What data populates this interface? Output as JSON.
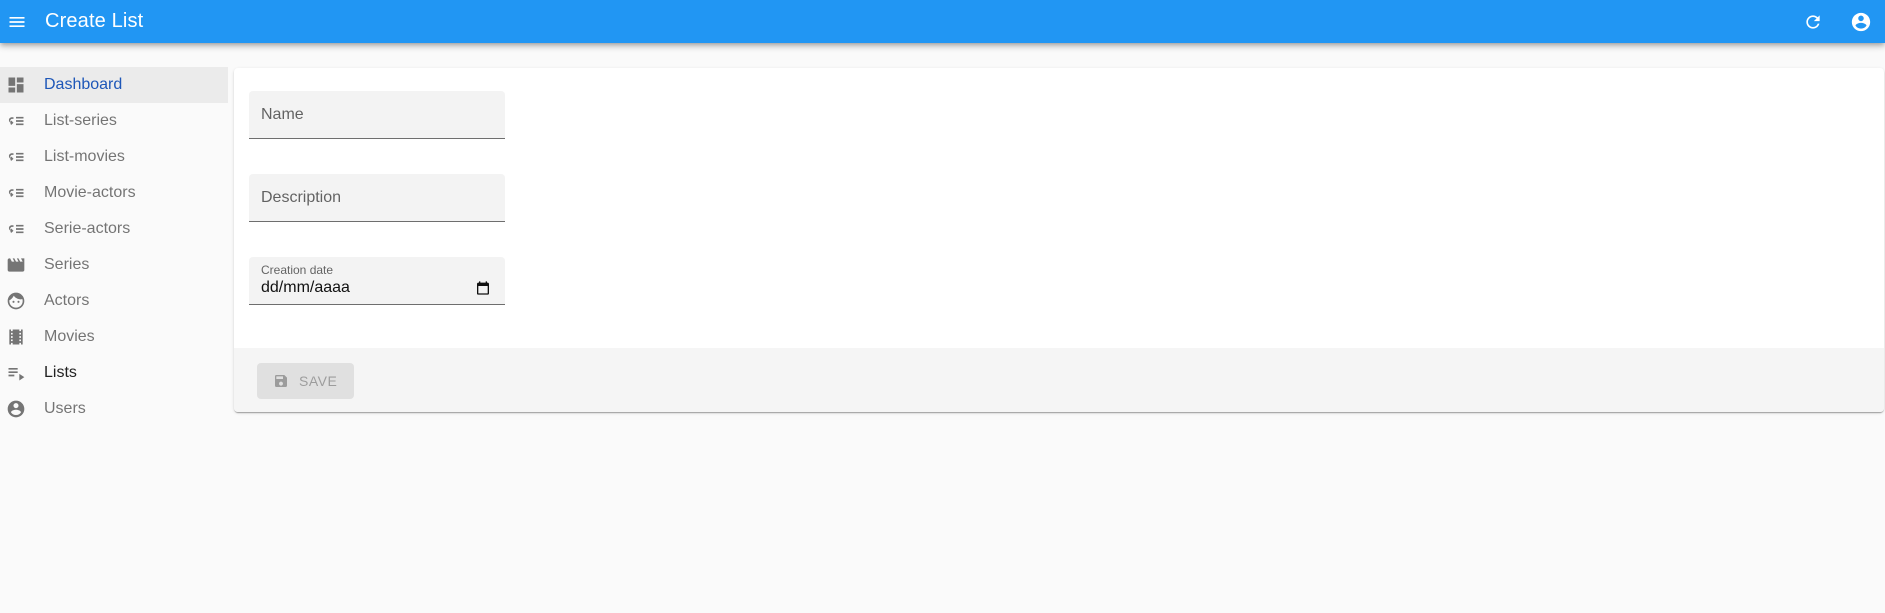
{
  "appbar": {
    "title": "Create List",
    "menu_icon": "menu-icon",
    "refresh_icon": "refresh-icon",
    "account_icon": "account-circle-icon",
    "color": "#2196f3"
  },
  "sidebar": {
    "items": [
      {
        "label": "Dashboard",
        "icon": "dashboard-icon"
      },
      {
        "label": "List-series",
        "icon": "list-icon"
      },
      {
        "label": "List-movies",
        "icon": "list-icon"
      },
      {
        "label": "Movie-actors",
        "icon": "list-icon"
      },
      {
        "label": "Serie-actors",
        "icon": "list-icon"
      },
      {
        "label": "Series",
        "icon": "clapperboard-icon"
      },
      {
        "label": "Actors",
        "icon": "face-icon"
      },
      {
        "label": "Movies",
        "icon": "film-icon"
      },
      {
        "label": "Lists",
        "icon": "playlist-icon"
      },
      {
        "label": "Users",
        "icon": "account-circle-icon"
      }
    ],
    "active_color": "#1e57b8"
  },
  "form": {
    "name_placeholder": "Name",
    "description_placeholder": "Description",
    "creation_date_label": "Creation date",
    "creation_date_value": "dd/mm/aaaa"
  },
  "toolbar": {
    "save_label": "SAVE",
    "save_icon": "save-icon"
  }
}
